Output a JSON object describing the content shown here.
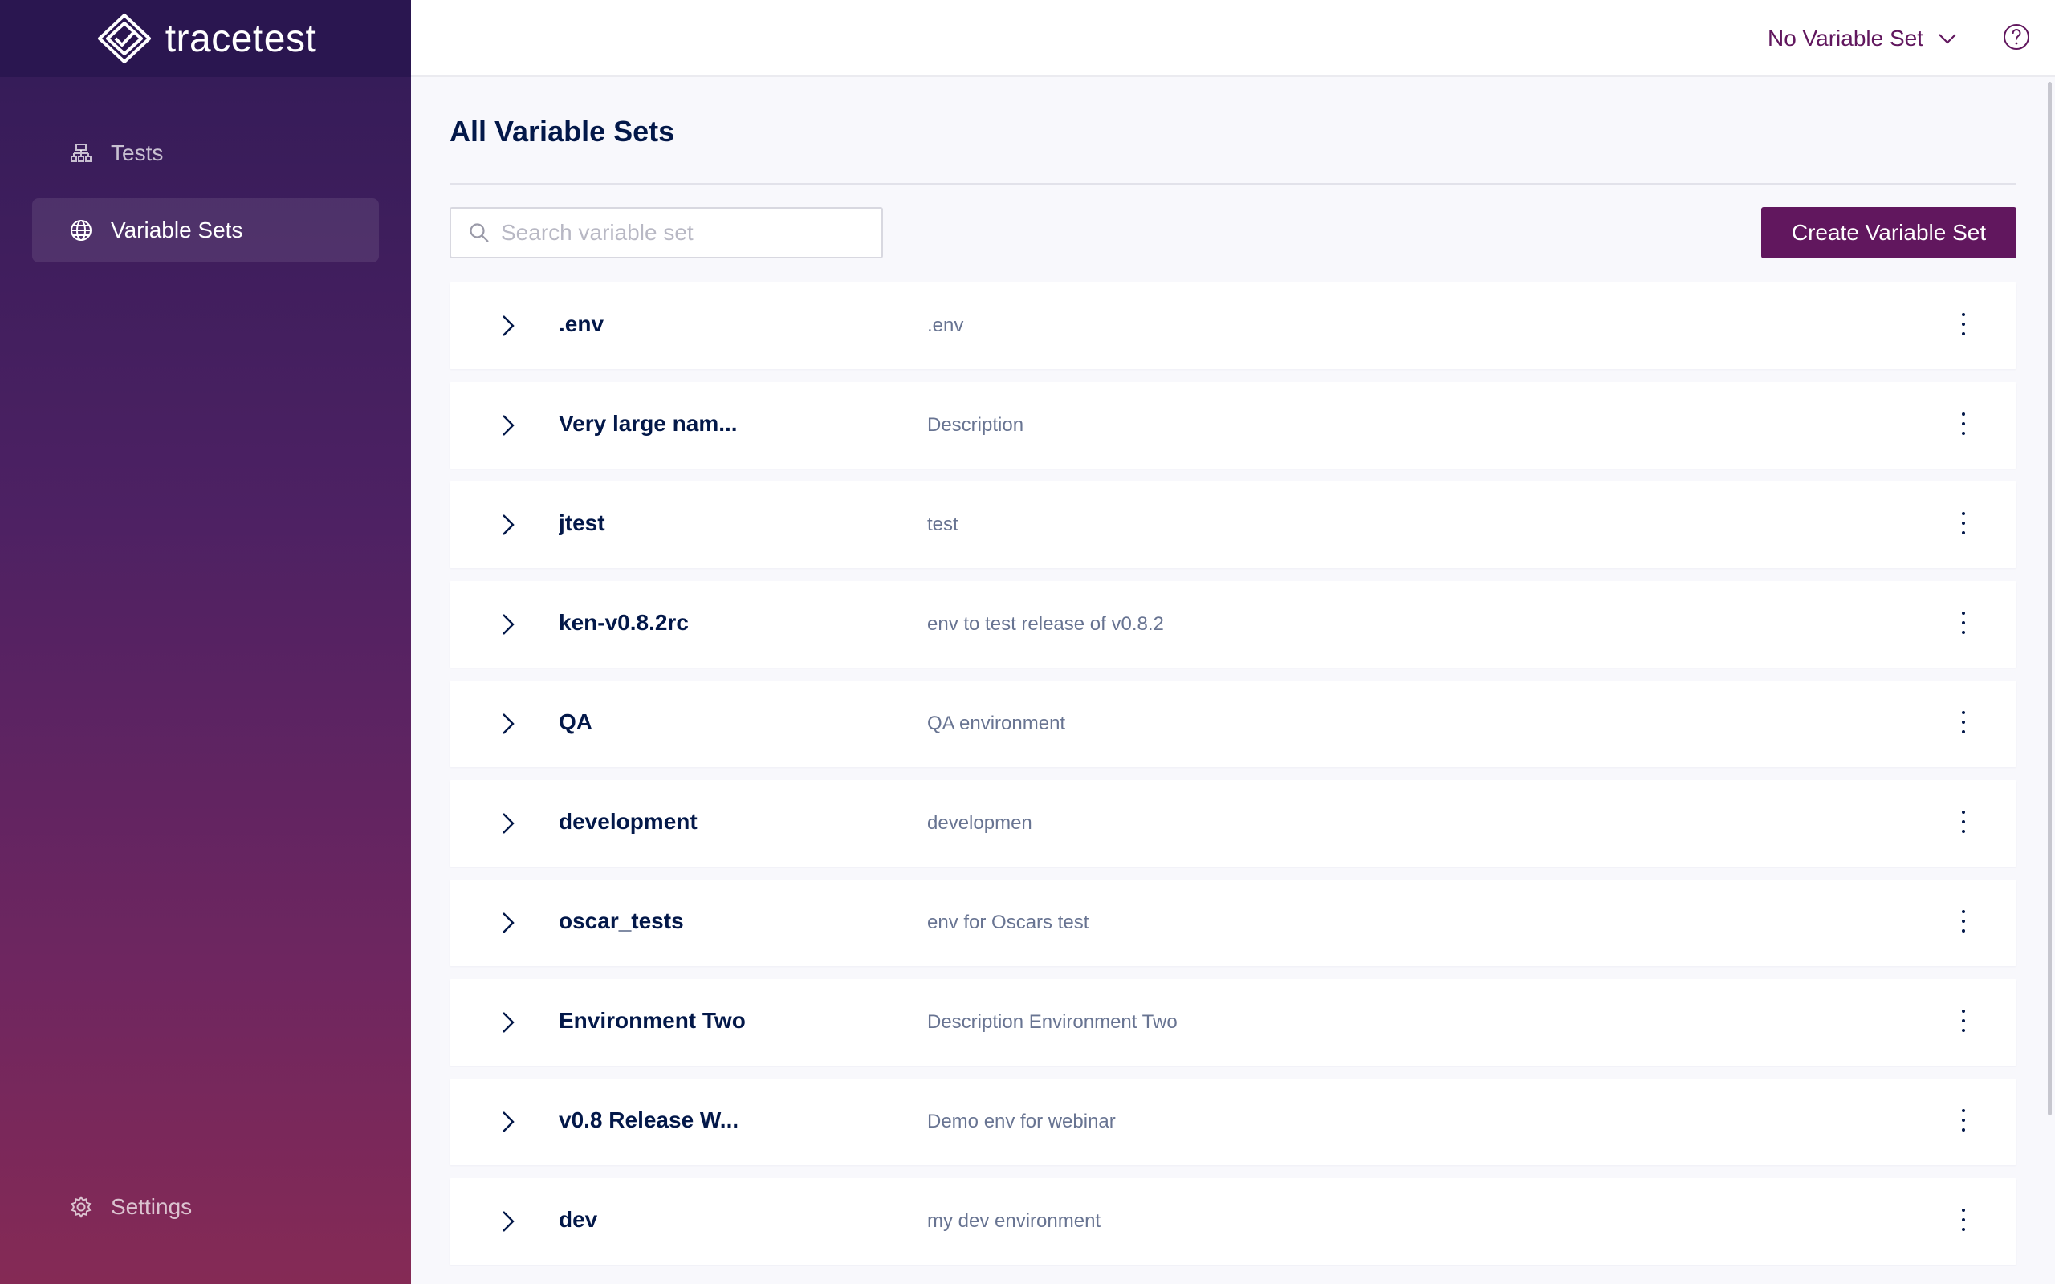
{
  "app": {
    "name": "tracetest"
  },
  "sidebar": {
    "items": [
      {
        "label": "Tests",
        "icon": "tests-hierarchy-icon",
        "active": false
      },
      {
        "label": "Variable Sets",
        "icon": "globe-icon",
        "active": true
      }
    ],
    "settings": {
      "label": "Settings",
      "icon": "gear-icon"
    }
  },
  "topbar": {
    "variable_set_selector": "No Variable Set",
    "help_icon": "question-circle-icon"
  },
  "main": {
    "title": "All Variable Sets",
    "search_placeholder": "Search variable set",
    "create_button": "Create Variable Set",
    "variable_sets": [
      {
        "name": ".env",
        "description": ".env"
      },
      {
        "name": "Very large nam...",
        "description": "Description"
      },
      {
        "name": "jtest",
        "description": "test"
      },
      {
        "name": "ken-v0.8.2rc",
        "description": "env to test release of v0.8.2"
      },
      {
        "name": "QA",
        "description": "QA environment"
      },
      {
        "name": "development",
        "description": "developmen"
      },
      {
        "name": "oscar_tests",
        "description": "env for Oscars test"
      },
      {
        "name": "Environment Two",
        "description": "Description Environment Two"
      },
      {
        "name": "v0.8 Release W...",
        "description": "Demo env for webinar"
      },
      {
        "name": "dev",
        "description": "my dev environment"
      }
    ]
  },
  "colors": {
    "primary": "#61175e",
    "sidebar_top": "#321b57",
    "sidebar_bottom": "#852a55",
    "text_dark": "#031849",
    "text_muted": "#687492"
  }
}
